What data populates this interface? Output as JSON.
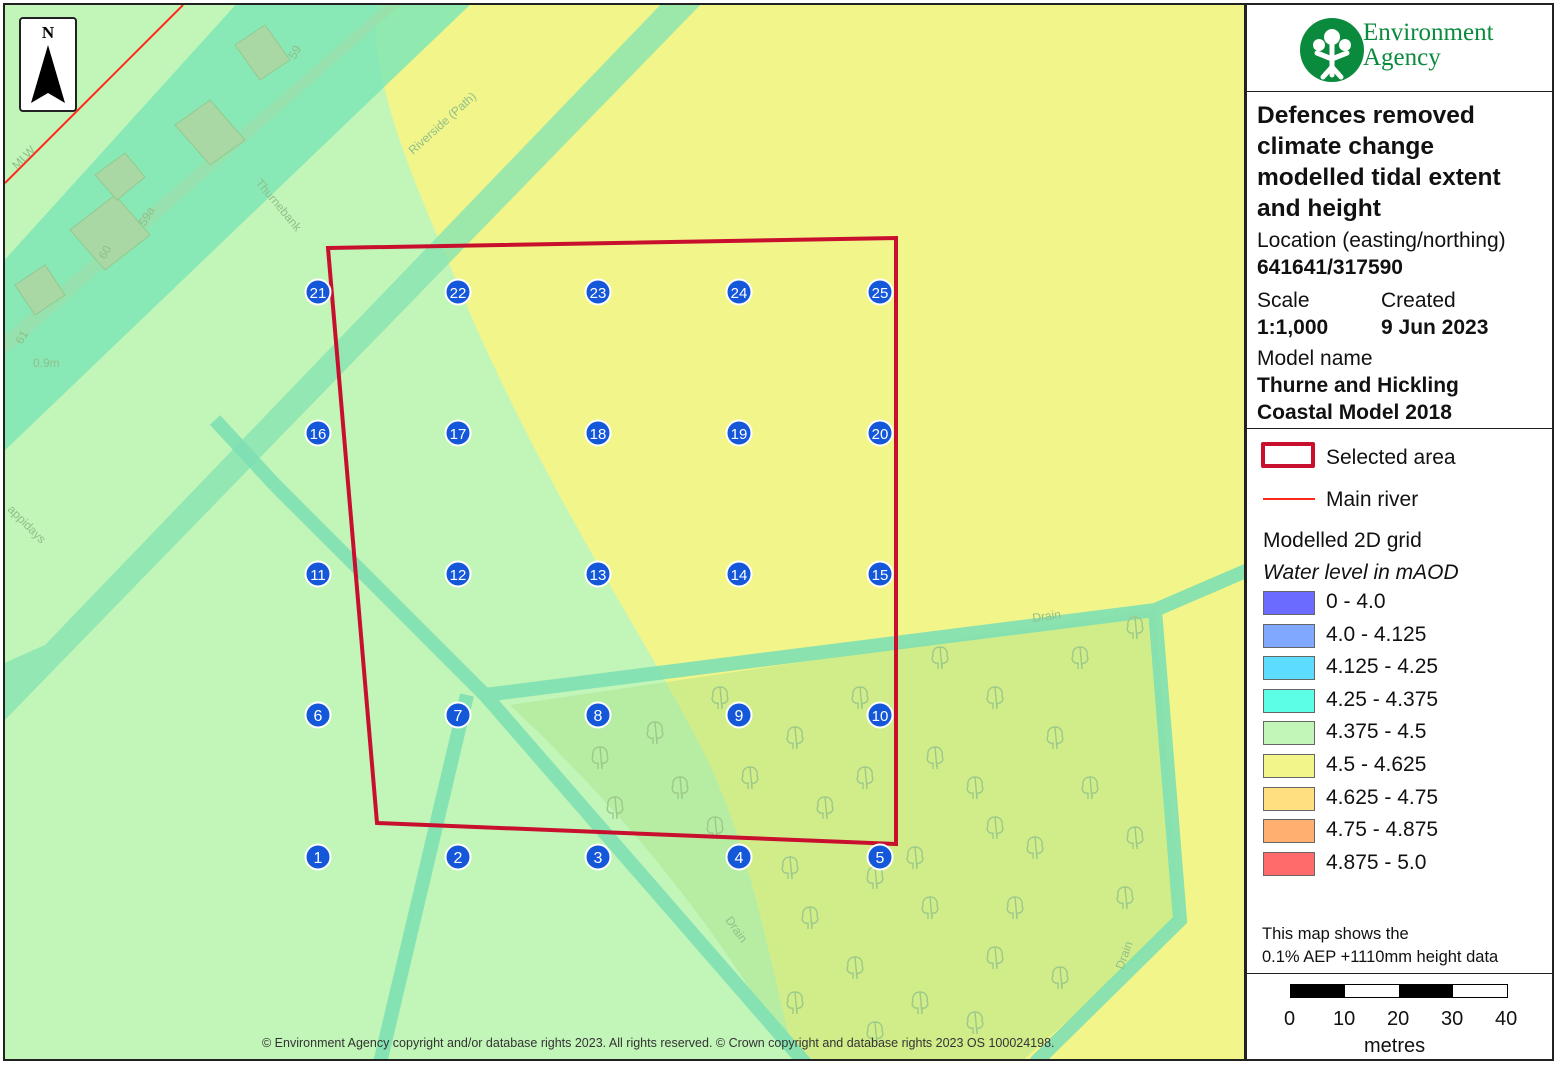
{
  "map": {
    "north_label": "N",
    "selected_area_color": "#c8102e",
    "main_river_color": "#ff2a1a",
    "labels": [
      {
        "text": "59",
        "icon": "street-label"
      },
      {
        "text": "Riverside (Path)",
        "icon": "street-label"
      },
      {
        "text": "Thurnebank",
        "icon": "street-label"
      },
      {
        "text": "59a",
        "icon": "street-label"
      },
      {
        "text": "60",
        "icon": "street-label"
      },
      {
        "text": "61",
        "icon": "street-label"
      },
      {
        "text": "0.9m",
        "icon": "street-label"
      },
      {
        "text": "MLW",
        "icon": "street-label"
      },
      {
        "text": "appidays",
        "icon": "street-label"
      },
      {
        "text": "Drain",
        "icon": "street-label"
      },
      {
        "text": "Drain",
        "icon": "street-label"
      },
      {
        "text": "Drain",
        "icon": "street-label"
      }
    ],
    "points": [
      "1",
      "2",
      "3",
      "4",
      "5",
      "6",
      "7",
      "8",
      "9",
      "10",
      "11",
      "12",
      "13",
      "14",
      "15",
      "16",
      "17",
      "18",
      "19",
      "20",
      "21",
      "22",
      "23",
      "24",
      "25"
    ],
    "copyright": "© Environment Agency copyright and/or database rights 2023. All rights reserved.    © Crown copyright and database rights 2023 OS 100024198."
  },
  "panel": {
    "logo_line1": "Environment",
    "logo_line2": "Agency",
    "title": "Defences removed climate change modelled tidal extent and height",
    "location_label": "Location (easting/northing)",
    "location_value": "641641/317590",
    "scale_label": "Scale",
    "scale_value": "1:1,000",
    "created_label": "Created",
    "created_value": "9 Jun 2023",
    "model_label": "Model name",
    "model_value": "Thurne and Hickling Coastal Model 2018",
    "legend": {
      "selected_area": "Selected area",
      "main_river": "Main river",
      "grid_title": "Modelled 2D grid",
      "grid_subtitle": "Water level in mAOD",
      "ranges": [
        {
          "label": "0 - 4.0",
          "color": "#6b6bff"
        },
        {
          "label": "4.0 - 4.125",
          "color": "#80a8ff"
        },
        {
          "label": "4.125 - 4.25",
          "color": "#5cdcff"
        },
        {
          "label": "4.25 - 4.375",
          "color": "#5cffe6"
        },
        {
          "label": "4.375 - 4.5",
          "color": "#c2f5b8"
        },
        {
          "label": "4.5 - 4.625",
          "color": "#f2f58a"
        },
        {
          "label": "4.625 - 4.75",
          "color": "#ffdf80"
        },
        {
          "label": "4.75 - 4.875",
          "color": "#ffb070"
        },
        {
          "label": "4.875 - 5.0",
          "color": "#ff6b6b"
        }
      ]
    },
    "note_line1": "This map shows the",
    "note_line2": "0.1% AEP +1110mm height data",
    "scalebar": {
      "ticks": [
        "0",
        "10",
        "20",
        "30",
        "40"
      ],
      "unit": "metres"
    }
  }
}
